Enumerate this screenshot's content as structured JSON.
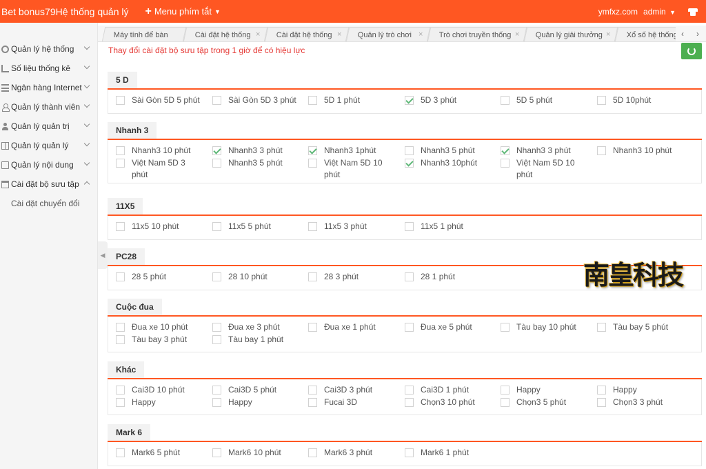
{
  "header": {
    "brand": "Bet bonus79Hệ thống quản lý",
    "menu_shortcut": "Menu phím tắt",
    "domain": "ymfxz.com",
    "user": "admin"
  },
  "sidebar": {
    "items": [
      {
        "label": "Quản lý hệ thống",
        "icon": "gear-icon"
      },
      {
        "label": "Số liệu thống kê",
        "icon": "chart-icon"
      },
      {
        "label": "Ngân hàng Internet",
        "icon": "list-icon"
      },
      {
        "label": "Quản lý thành viên",
        "icon": "user-icon"
      },
      {
        "label": "Quản lý quản trị",
        "icon": "person-icon"
      },
      {
        "label": "Quản lý quản lý",
        "icon": "grid-icon"
      },
      {
        "label": "Quản lý nội dung",
        "icon": "book-icon"
      },
      {
        "label": "Cài đặt bộ sưu tập",
        "icon": "folder-icon"
      }
    ],
    "sub_items": [
      "Cài đặt chuyển đổi"
    ]
  },
  "tabs": [
    {
      "label": "Máy tính để bàn"
    },
    {
      "label": "Cài đặt hệ thống"
    },
    {
      "label": "Cài đặt hệ thống"
    },
    {
      "label": "Quản lý trò chơi"
    },
    {
      "label": "Trò chơi truyền thống"
    },
    {
      "label": "Quản lý giải thưởng"
    },
    {
      "label": "Xổ số hệ thống"
    }
  ],
  "notice": "Thay đổi cài đặt bộ sưu tập trong 1 giờ để có hiệu lực",
  "logo_text": "南皇科技",
  "sections": [
    {
      "title": "5 D",
      "options": [
        {
          "label": "Sài Gòn 5D 5 phút",
          "checked": false
        },
        {
          "label": "Sài Gòn 5D 3 phút",
          "checked": false
        },
        {
          "label": "5D 1 phút",
          "checked": false
        },
        {
          "label": "5D 3 phút",
          "checked": true
        },
        {
          "label": "5D 5 phút",
          "checked": false
        },
        {
          "label": "5D 10phút",
          "checked": false
        }
      ]
    },
    {
      "title": "Nhanh 3",
      "options": [
        {
          "label": "Nhanh3 10 phút",
          "checked": false
        },
        {
          "label": "Nhanh3 3 phút",
          "checked": true
        },
        {
          "label": "Nhanh3 1phút",
          "checked": true
        },
        {
          "label": "Nhanh3 5 phút",
          "checked": false
        },
        {
          "label": "Nhanh3 3 phút",
          "checked": true
        },
        {
          "label": "Nhanh3 10 phút",
          "checked": false
        },
        {
          "label": "Việt Nam 5D 3 phút",
          "checked": false
        },
        {
          "label": "Nhanh3 5 phút",
          "checked": false
        },
        {
          "label": "Việt Nam 5D 10 phút",
          "checked": false
        },
        {
          "label": "Nhanh3 10phút",
          "checked": true
        },
        {
          "label": "Việt Nam 5D 10 phút",
          "checked": false
        }
      ]
    },
    {
      "title": "11X5",
      "options": [
        {
          "label": "11x5 10 phút",
          "checked": false
        },
        {
          "label": "11x5 5 phút",
          "checked": false
        },
        {
          "label": "11x5 3 phút",
          "checked": false
        },
        {
          "label": "11x5 1 phút",
          "checked": false
        }
      ]
    },
    {
      "title": "PC28",
      "options": [
        {
          "label": "28 5 phút",
          "checked": false
        },
        {
          "label": "28 10 phút",
          "checked": false
        },
        {
          "label": "28 3 phút",
          "checked": false
        },
        {
          "label": "28 1 phút",
          "checked": false
        }
      ]
    },
    {
      "title": "Cuộc đua",
      "options": [
        {
          "label": "Đua xe 10 phút",
          "checked": false
        },
        {
          "label": "Đua xe 3 phút",
          "checked": false
        },
        {
          "label": "Đua xe 1 phút",
          "checked": false
        },
        {
          "label": "Đua xe 5 phút",
          "checked": false
        },
        {
          "label": "Tàu bay 10 phút",
          "checked": false
        },
        {
          "label": "Tàu bay 5 phút",
          "checked": false
        },
        {
          "label": "Tàu bay 3 phút",
          "checked": false
        },
        {
          "label": "Tàu bay 1 phút",
          "checked": false
        }
      ]
    },
    {
      "title": "Khác",
      "options": [
        {
          "label": "Cai3D 10 phút",
          "checked": false
        },
        {
          "label": "Cai3D 5 phút",
          "checked": false
        },
        {
          "label": "Cai3D 3 phút",
          "checked": false
        },
        {
          "label": "Cai3D 1 phút",
          "checked": false
        },
        {
          "label": "Happy",
          "checked": false
        },
        {
          "label": "Happy",
          "checked": false
        },
        {
          "label": "Happy",
          "checked": false
        },
        {
          "label": "Happy",
          "checked": false
        },
        {
          "label": "Fucai 3D",
          "checked": false
        },
        {
          "label": "Chọn3 10 phút",
          "checked": false
        },
        {
          "label": "Chọn3 5 phút",
          "checked": false
        },
        {
          "label": "Chọn3 3 phút",
          "checked": false
        }
      ]
    },
    {
      "title": "Mark 6",
      "options": [
        {
          "label": "Mark6 5 phút",
          "checked": false
        },
        {
          "label": "Mark6 10 phút",
          "checked": false
        },
        {
          "label": "Mark6 3 phút",
          "checked": false
        },
        {
          "label": "Mark6 1 phút",
          "checked": false
        }
      ]
    }
  ],
  "colors": {
    "accent": "#ff5722",
    "check": "#5fb878",
    "notice": "#e53935",
    "refresh": "#4caf50"
  }
}
